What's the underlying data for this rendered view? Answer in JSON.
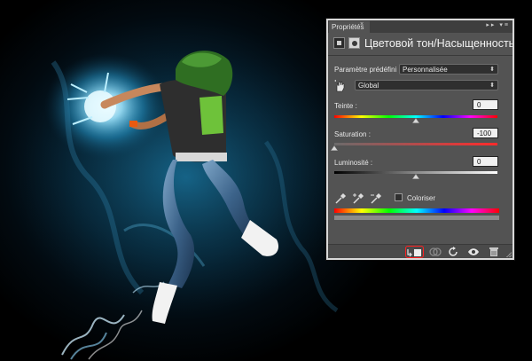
{
  "panel": {
    "tab_label": "Propriétés",
    "close_glyph": "×",
    "controls_glyph": "▸▸ ▾≡",
    "title": "Цветовой тон/Насыщенность",
    "preset": {
      "label": "Paramètre prédéfini :",
      "value": "Personnalisée"
    },
    "channel": {
      "value": "Global"
    },
    "hue": {
      "label": "Teinte :",
      "value": "0",
      "level": 0
    },
    "saturation": {
      "label": "Saturation :",
      "value": "-100",
      "level": -100
    },
    "lightness": {
      "label": "Luminosité :",
      "value": "0",
      "level": 0
    },
    "colorize": {
      "label": "Coloriser",
      "checked": false
    }
  },
  "icons": {
    "adjustment": "hue-saturation-icon",
    "mask": "mask-icon",
    "hand": "targeted-adjust-hand-icon",
    "eyedroppers": [
      "eyedropper-icon",
      "eyedropper-plus-icon",
      "eyedropper-minus-icon"
    ],
    "bottom": [
      "clip-to-layer-icon",
      "view-previous-state-icon",
      "reset-icon",
      "visibility-eye-icon",
      "trash-icon"
    ]
  },
  "colors": {
    "panel_bg": "#535353",
    "accent_highlight": "#ff2020",
    "glow": "#3fc8ff"
  }
}
